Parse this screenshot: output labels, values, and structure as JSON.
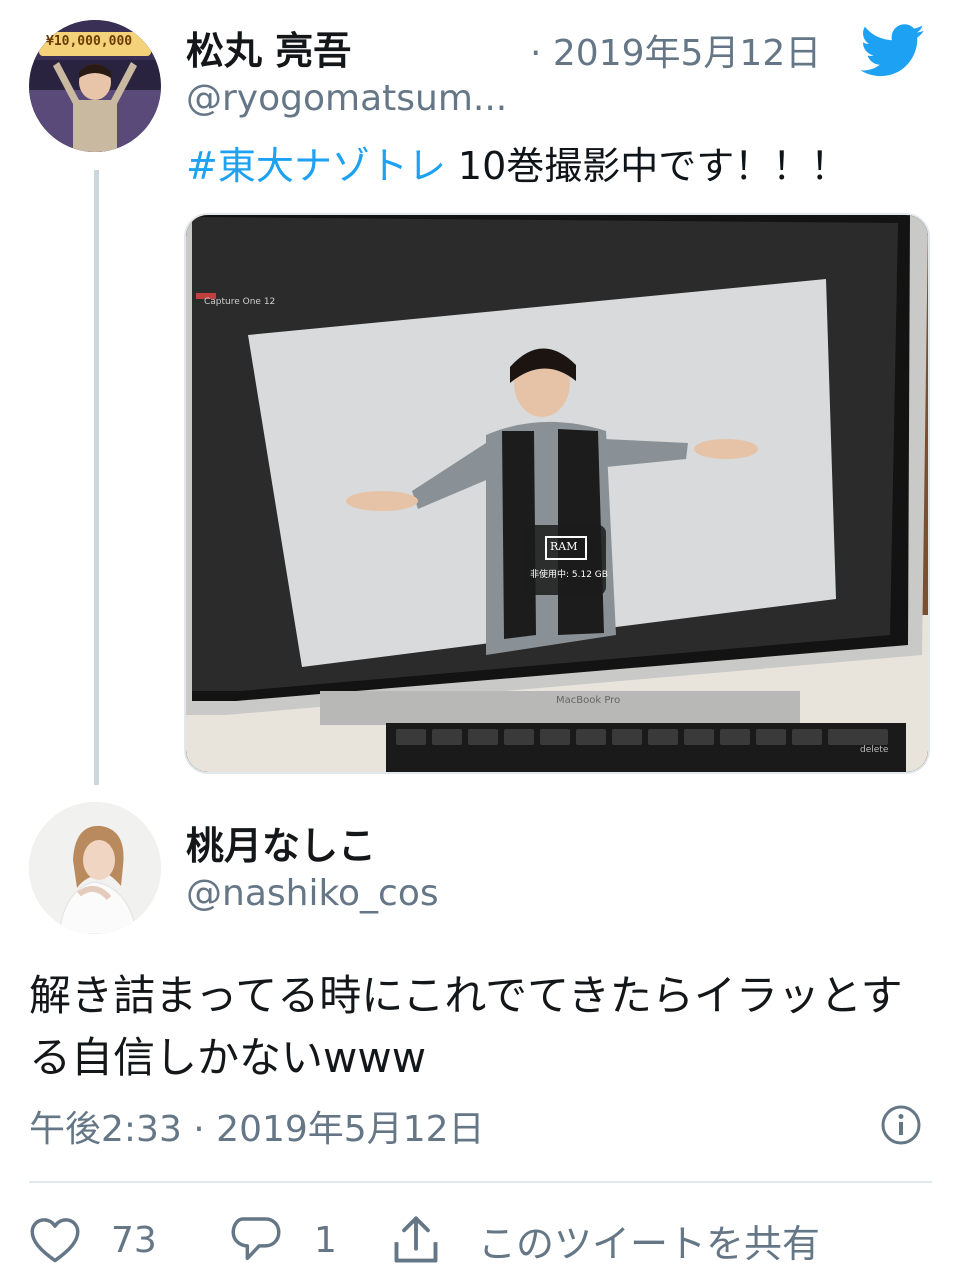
{
  "parent_tweet": {
    "author_name": "松丸 亮吾",
    "handle": "@ryogomatsum...",
    "date": "· 2019年5月12日",
    "hashtag": "#東大ナゾトレ",
    "text": " 10巻撮影中です！！！",
    "avatar_banner": "¥10,000,000",
    "photo": {
      "app_name": "Capture One 12",
      "ram_label": "RAM",
      "ram_usage": "非使用中: 5.12 GB",
      "laptop_label": "MacBook Pro",
      "key_delete": "delete"
    }
  },
  "reply_tweet": {
    "author_name": "桃月なしこ",
    "handle": "@nashiko_cos",
    "text_line1": "解き詰まってる時にこれでてきたらイラッとす",
    "text_line2": "る自信しかないwww",
    "timestamp": "午後2:33 · 2019年5月12日"
  },
  "actions": {
    "like_count": "73",
    "reply_count": "1",
    "share_label": "このツイートを共有"
  },
  "colors": {
    "accent": "#1da1f2",
    "muted": "#657786",
    "divider": "#e1e8ed"
  },
  "icons": [
    "twitter-bird-icon",
    "info-icon",
    "heart-icon",
    "reply-icon",
    "share-icon"
  ]
}
